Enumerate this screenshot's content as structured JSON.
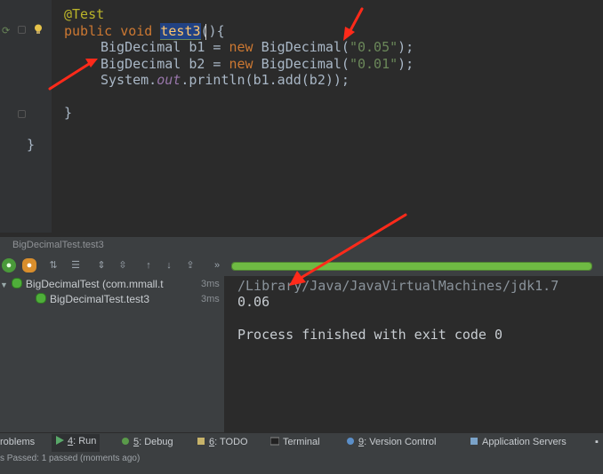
{
  "editor": {
    "annotation": "@Test",
    "kw_public": "public",
    "kw_void": "void",
    "method_name": "test3",
    "method_tail": "(){",
    "line_b1": {
      "type": "BigDecimal b1 = ",
      "kw_new": "new",
      "ctor": " BigDecimal(",
      "str": "\"0.05\"",
      "end": ");"
    },
    "line_b2": {
      "type": "BigDecimal b2 = ",
      "kw_new": "new",
      "ctor": " BigDecimal(",
      "str": "\"0.01\"",
      "end": ");"
    },
    "println": {
      "pre": "System.",
      "field": "out",
      "post": ".println(b1.add(b2));"
    },
    "close_method": "}",
    "close_class": "}"
  },
  "run_panel": {
    "title": "BigDecimalTest.test3",
    "progress_fraction": 1.0,
    "tree": [
      {
        "label": "BigDecimalTest (com.mmall.t",
        "time": "3ms"
      },
      {
        "label": "BigDecimalTest.test3",
        "time": "3ms"
      }
    ],
    "console": {
      "path": "/Library/Java/JavaVirtualMachines/jdk1.7",
      "output": "0.06",
      "exit": "Process finished with exit code 0"
    }
  },
  "tool_windows": {
    "problems": "roblems",
    "run_num": "4",
    "run_label": ": Run",
    "debug_num": "5",
    "debug_label": ": Debug",
    "todo_num": "6",
    "todo_label": ": TODO",
    "terminal": "Terminal",
    "vc_num": "9",
    "vc_label": ": Version Control",
    "app_servers": "Application Servers"
  },
  "status": {
    "text": "s Passed: 1 passed (moments ago)"
  },
  "colors": {
    "annotation_arrows": "#ff2a1a",
    "pass_green": "#4fae3a"
  },
  "icons": [
    "run-icon",
    "debug-icon",
    "todo-icon",
    "terminal-icon",
    "version-control-icon",
    "app-servers-icon",
    "lightbulb-icon",
    "pass-icon"
  ]
}
